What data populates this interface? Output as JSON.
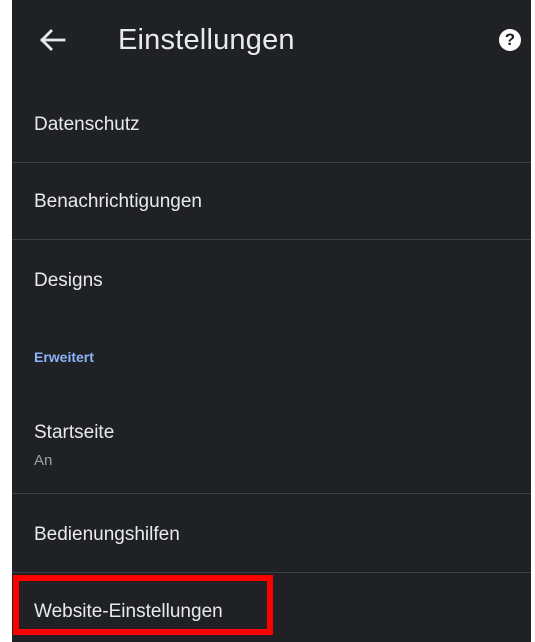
{
  "app_bar": {
    "back_icon": "arrow-back-icon",
    "title": "Einstellungen",
    "help_icon": "help-icon",
    "help_glyph": "?"
  },
  "settings": {
    "datenschutz": "Datenschutz",
    "benachrichtigungen": "Benachrichtigungen",
    "designs": "Designs",
    "advanced_header": "Erweitert",
    "startseite": "Startseite",
    "startseite_value": "An",
    "bedienungshilfen": "Bedienungshilfen",
    "website_einstellungen": "Website-Einstellungen"
  },
  "colors": {
    "background": "#202124",
    "text_primary": "#e8eaed",
    "text_secondary": "#9aa0a6",
    "accent": "#8ab4f8",
    "divider": "#3c4043",
    "highlight": "#ff0000"
  }
}
